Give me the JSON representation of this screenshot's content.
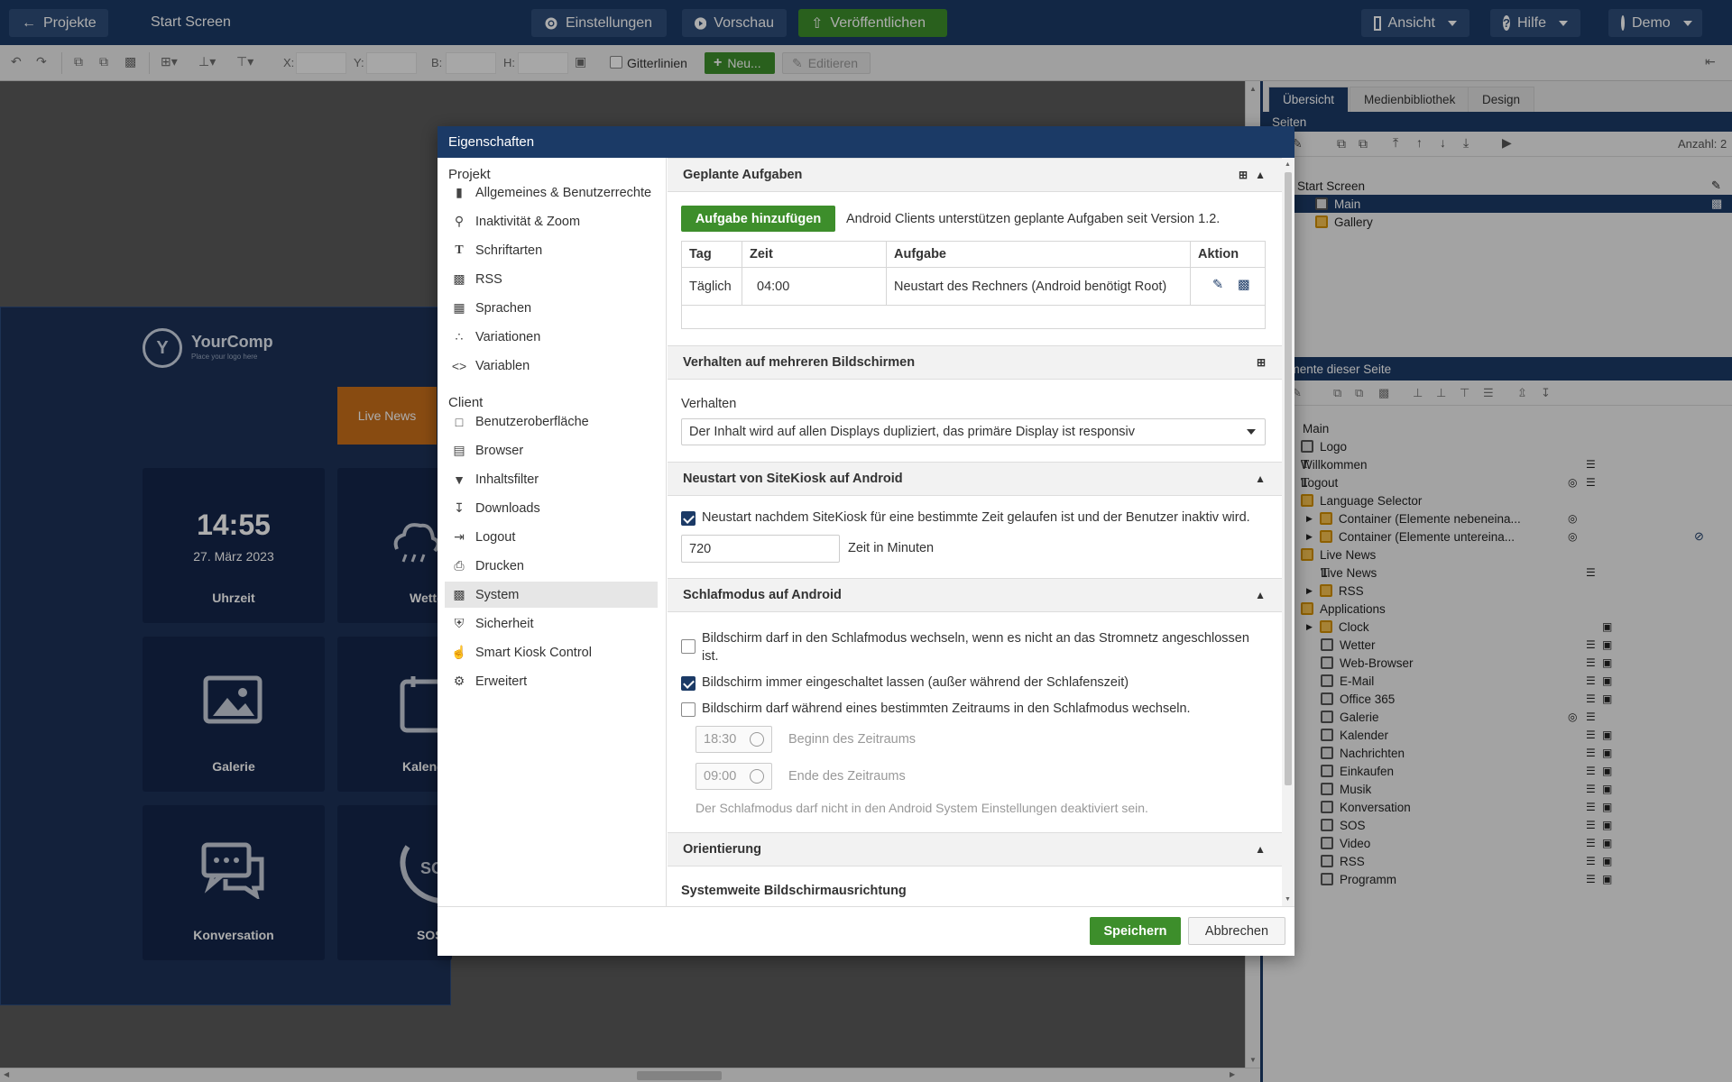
{
  "topbar": {
    "projects": "Projekte",
    "screen_name": "Start Screen",
    "settings": "Einstellungen",
    "preview": "Vorschau",
    "publish": "Veröffentlichen",
    "view": "Ansicht",
    "help": "Hilfe",
    "user": "Demo"
  },
  "toolbar": {
    "x_label": "X:",
    "y_label": "Y:",
    "w_label": "B:",
    "h_label": "H:",
    "grid_label": "Gitterlinien",
    "new_label": "Neu...",
    "edit_label": "Editieren"
  },
  "preview": {
    "logo_name": "YourComp",
    "logo_tag": "Place your logo here",
    "live_news": "Live News",
    "clock_time": "14:55",
    "clock_date": "27. März 2023",
    "tiles": [
      "Uhrzeit",
      "Wette",
      "Galerie",
      "Kalend",
      "Konversation",
      "SOS"
    ]
  },
  "right_panel": {
    "tabs": [
      "Übersicht",
      "Medienbibliothek",
      "Design"
    ],
    "pages_header": "Seiten",
    "count_label": "Anzahl: 2",
    "pages_tree": [
      "Start Screen",
      "Main",
      "Gallery"
    ],
    "elements_header": "Elemente dieser Seite",
    "elements_tree": [
      "Main",
      "Logo",
      "Willkommen",
      "Logout",
      "Language Selector",
      "Container (Elemente nebeneina...",
      "Container (Elemente untereina...",
      "Live News",
      "Live News",
      "RSS",
      "Applications",
      "Clock",
      "Wetter",
      "Web-Browser",
      "E-Mail",
      "Office 365",
      "Galerie",
      "Kalender",
      "Nachrichten",
      "Einkaufen",
      "Musik",
      "Konversation",
      "SOS",
      "Video",
      "RSS",
      "Programm"
    ]
  },
  "dialog": {
    "title": "Eigenschaften",
    "nav_project_header": "Projekt",
    "nav_project": [
      {
        "label": "Allgemeines & Benutzerrechte",
        "icon": "folder-icon"
      },
      {
        "label": "Inaktivität & Zoom",
        "icon": "zoom-icon"
      },
      {
        "label": "Schriftarten",
        "icon": "font-icon"
      },
      {
        "label": "RSS",
        "icon": "rss-icon"
      },
      {
        "label": "Sprachen",
        "icon": "language-icon"
      },
      {
        "label": "Variationen",
        "icon": "variations-icon"
      },
      {
        "label": "Variablen",
        "icon": "code-icon"
      }
    ],
    "nav_client_header": "Client",
    "nav_client": [
      {
        "label": "Benutzeroberfläche",
        "icon": "user-interface-icon"
      },
      {
        "label": "Browser",
        "icon": "browser-icon"
      },
      {
        "label": "Inhaltsfilter",
        "icon": "filter-icon"
      },
      {
        "label": "Downloads",
        "icon": "download-icon"
      },
      {
        "label": "Logout",
        "icon": "logout-icon"
      },
      {
        "label": "Drucken",
        "icon": "print-icon"
      },
      {
        "label": "System",
        "icon": "system-icon"
      },
      {
        "label": "Sicherheit",
        "icon": "shield-icon"
      },
      {
        "label": "Smart Kiosk Control",
        "icon": "hand-icon"
      },
      {
        "label": "Erweitert",
        "icon": "gear-icon"
      }
    ],
    "tasks": {
      "title": "Geplante Aufgaben",
      "add_button": "Aufgabe hinzufügen",
      "note": "Android Clients unterstützen geplante Aufgaben seit Version 1.2.",
      "columns": [
        "Tag",
        "Zeit",
        "Aufgabe",
        "Aktion"
      ],
      "rows": [
        [
          "Täglich",
          "04:00",
          "Neustart des Rechners (Android benötigt Root)"
        ]
      ]
    },
    "multi": {
      "title": "Verhalten auf mehreren Bildschirmen",
      "label": "Verhalten",
      "value": "Der Inhalt wird auf allen Displays dupliziert, das primäre Display ist responsiv"
    },
    "restart": {
      "title": "Neustart von SiteKiosk auf Android",
      "checkbox": "Neustart nachdem SiteKiosk für eine bestimmte Zeit gelaufen ist und der Benutzer inaktiv wird.",
      "minutes": "720",
      "minutes_label": "Zeit in Minuten"
    },
    "sleep": {
      "title": "Schlafmodus auf Android",
      "opt1": "Bildschirm darf in den Schlafmodus wechseln, wenn es nicht an das Stromnetz angeschlossen ist.",
      "opt2": "Bildschirm immer eingeschaltet lassen (außer während der Schlafenszeit)",
      "opt3": "Bildschirm darf während eines bestimmten Zeitraums in den Schlafmodus wechseln.",
      "start_time": "18:30",
      "start_label": "Beginn des Zeitraums",
      "end_time": "09:00",
      "end_label": "Ende des Zeitraums",
      "hint": "Der Schlafmodus darf nicht in den Android System Einstellungen deaktiviert sein."
    },
    "orientation": {
      "title": "Orientierung",
      "label": "Systemweite Bildschirmausrichtung"
    },
    "save": "Speichern",
    "cancel": "Abbrechen"
  },
  "colors": {
    "brand": "#1b3a66",
    "green": "#3d8e2b",
    "orange": "#c96f1a",
    "tile": "#14264a"
  }
}
